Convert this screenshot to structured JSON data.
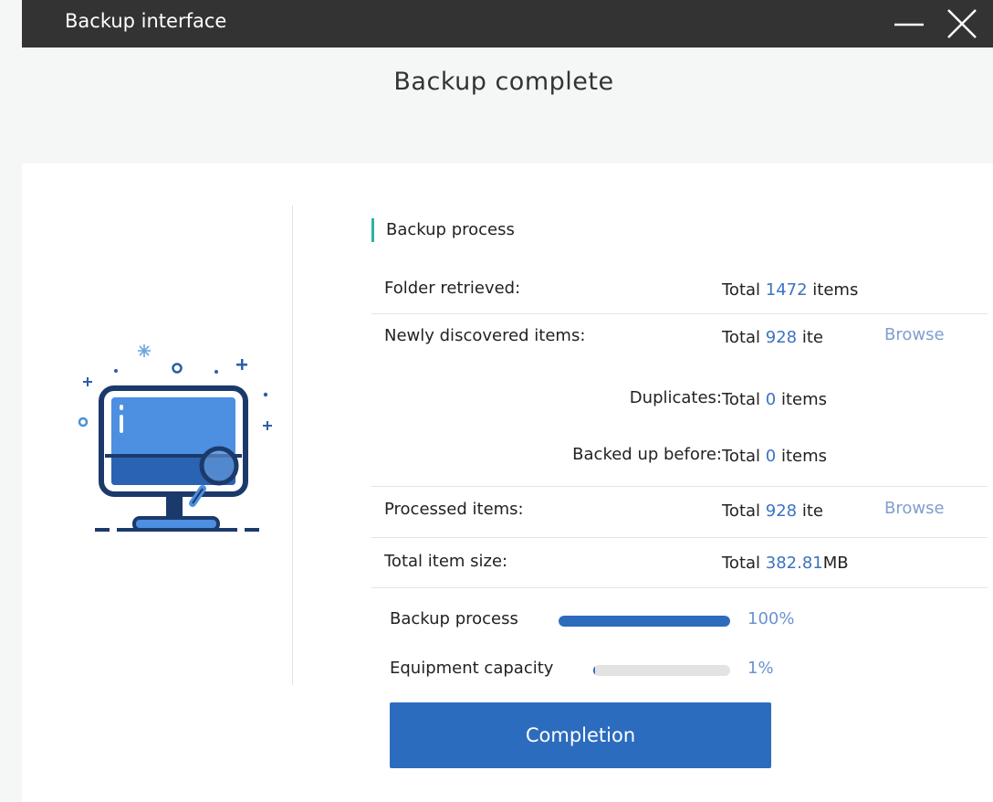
{
  "window": {
    "title": "Backup interface"
  },
  "heading": "Backup complete",
  "section_title": "Backup process",
  "rows": [
    {
      "label": "Folder retrieved:",
      "prefix": "Total ",
      "number": "1472",
      "suffix": " items"
    },
    {
      "label": "Newly discovered items:",
      "prefix": "Total ",
      "number": "928",
      "suffix": " ite",
      "action": "Browse"
    },
    {
      "label": "Duplicates:",
      "prefix": "Total ",
      "number": "0",
      "suffix": " items"
    },
    {
      "label": "Backed up before:",
      "prefix": "Total ",
      "number": "0",
      "suffix": " items"
    },
    {
      "label": "Processed items:",
      "prefix": "Total ",
      "number": "928",
      "suffix": " ite",
      "action": "Browse"
    },
    {
      "label": "Total item size:",
      "prefix": "Total ",
      "number": "382.81",
      "suffix": "MB"
    }
  ],
  "progress": [
    {
      "label": "Backup process",
      "percent_label": "100%",
      "value": 1.0
    },
    {
      "label": "Equipment capacity",
      "percent_label": "1%",
      "value": 0.01
    }
  ],
  "complete_button": "Completion",
  "colors": {
    "titlebar": "#333333",
    "accent": "#2c6cbf",
    "number": "#3b73c2",
    "link": "#7f9ed0",
    "section_marker": "#2bb3a2",
    "track": "#e3e3e3"
  },
  "icons": [
    "minimize-icon",
    "close-icon",
    "computer-search-icon"
  ]
}
